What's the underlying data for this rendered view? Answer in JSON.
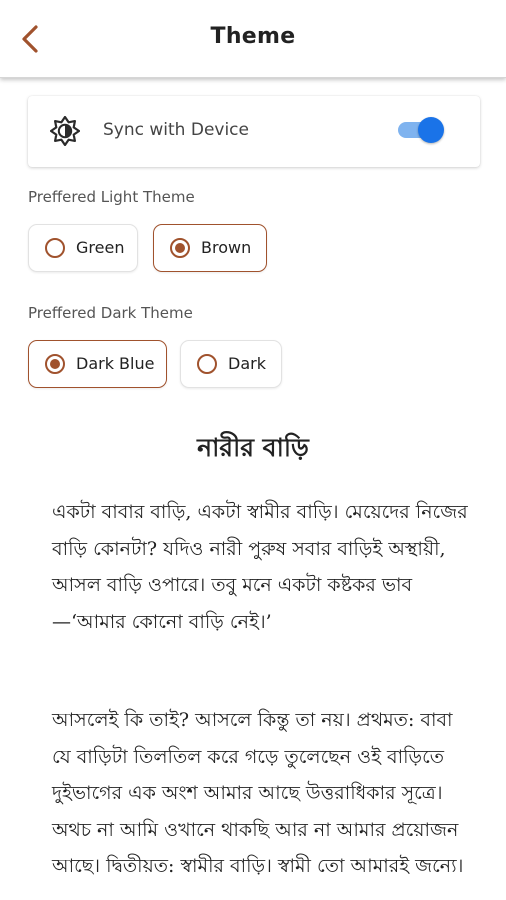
{
  "header": {
    "title": "Theme",
    "back_icon": "chevron-left-icon",
    "accent_color": "#a0522d"
  },
  "sync": {
    "icon": "brightness-icon",
    "label": "Sync with Device",
    "enabled": true,
    "toggle_color": "#1a73e8"
  },
  "light_theme": {
    "label": "Preffered Light Theme",
    "options": [
      {
        "label": "Green",
        "selected": false
      },
      {
        "label": "Brown",
        "selected": true
      }
    ]
  },
  "dark_theme": {
    "label": "Preffered Dark Theme",
    "options": [
      {
        "label": "Dark Blue",
        "selected": true
      },
      {
        "label": "Dark",
        "selected": false
      }
    ]
  },
  "article": {
    "title": "নারীর বাড়ি",
    "paragraphs": [
      "একটা বাবার বাড়ি, একটা স্বামীর বাড়ি। মেয়েদের নিজের বাড়ি কোনটা? যদিও নারী পুরুষ সবার বাড়িই অস্থায়ী, আসল বাড়ি ওপারে। তবু মনে একটা কষ্টকর ভাব—‘আমার কোনো বাড়ি নেই।’",
      "আসলেই কি তাই? আসলে কিন্তু তা নয়। প্রথমত: বাবা যে বাড়িটা তিলতিল করে গড়ে তুলেছেন ওই বাড়িতে দুইভাগের এক অংশ আমার আছে উত্তরাধিকার সূত্রে। অথচ না আমি ওখানে থাকছি আর না আমার প্রয়োজন আছে। দ্বিতীয়ত: স্বামীর বাড়ি। স্বামী তো আমারই জন্যে।"
    ]
  }
}
